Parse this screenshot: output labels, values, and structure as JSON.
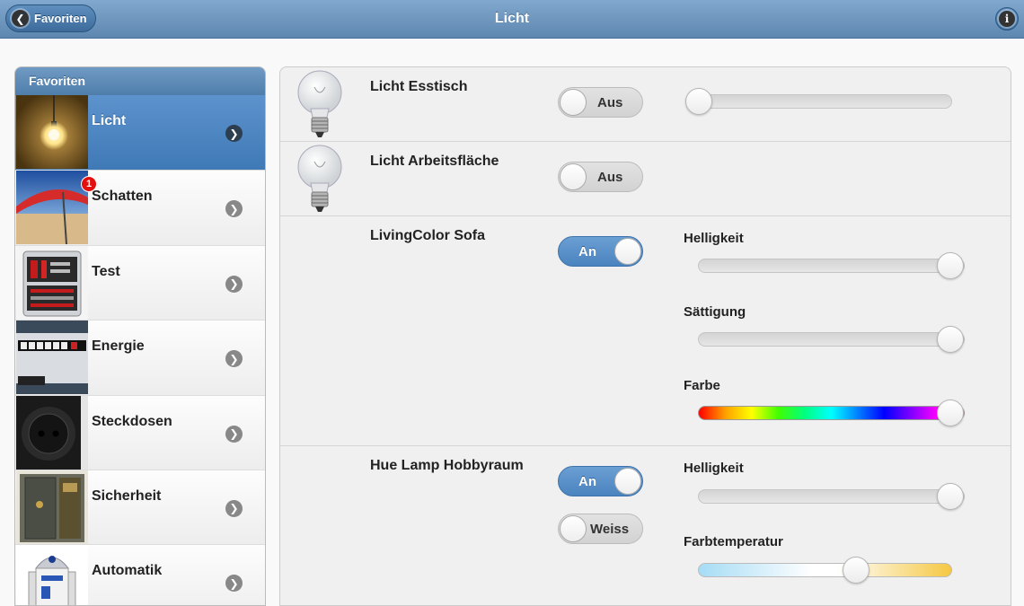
{
  "header": {
    "title": "Licht",
    "back_label": "Favoriten",
    "info_icon": "info-icon"
  },
  "sidebar": {
    "title": "Favoriten",
    "items": [
      {
        "label": "Licht",
        "active": true,
        "badge": ""
      },
      {
        "label": "Schatten",
        "active": false,
        "badge": "1"
      },
      {
        "label": "Test",
        "active": false,
        "badge": ""
      },
      {
        "label": "Energie",
        "active": false,
        "badge": ""
      },
      {
        "label": "Steckdosen",
        "active": false,
        "badge": ""
      },
      {
        "label": "Sicherheit",
        "active": false,
        "badge": ""
      },
      {
        "label": "Automatik",
        "active": false,
        "badge": ""
      }
    ]
  },
  "devices": [
    {
      "name": "Licht Esstisch",
      "toggle": "Aus",
      "on": false,
      "dimmer": 0
    },
    {
      "name": "Licht Arbeitsfläche",
      "toggle": "Aus",
      "on": false
    },
    {
      "name": "LivingColor Sofa",
      "toggle": "An",
      "on": true,
      "sliders": [
        {
          "label": "Helligkeit",
          "value": 1.0
        },
        {
          "label": "Sättigung",
          "value": 1.0
        },
        {
          "label": "Farbe",
          "value": 1.0
        }
      ]
    },
    {
      "name": "Hue Lamp Hobbyraum",
      "toggle": "An",
      "on": true,
      "mode_toggle": "Weiss",
      "sliders": [
        {
          "label": "Helligkeit",
          "value": 1.0
        },
        {
          "label": "Farbtemperatur",
          "value": 0.6
        }
      ]
    }
  ],
  "colors": {
    "header": "#6f98c2",
    "active_item": "#4a84c0",
    "badge": "#e41010"
  }
}
